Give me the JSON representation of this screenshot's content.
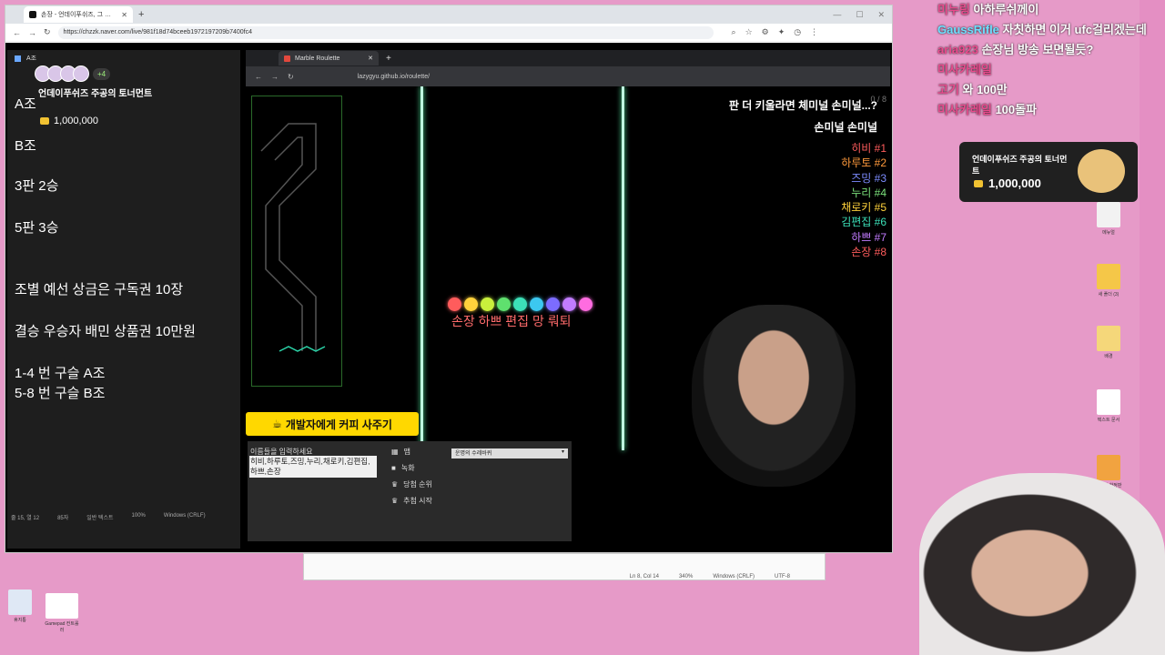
{
  "outer_browser": {
    "tab_title": "손장 - 언데이푸쉬즈, 그 주공의 토너먼트",
    "url": "https://chzzk.naver.com/live/981f18d74bceeb1972197209b7400fc4"
  },
  "notes": {
    "tab_label": "A조",
    "lines": [
      "A조",
      "B조",
      "3판 2승",
      "5판 3승",
      "조별 예선 상금은 구독권 10장",
      "결승 우승자 배민 상품권 10만원",
      "1-4 번 구슬 A조",
      "5-8 번 구슬 B조"
    ],
    "status": [
      "줄 15, 열 12",
      "85자",
      "일반 텍스트",
      "100%",
      "Windows (CRLF)"
    ]
  },
  "tourney_widget": {
    "more_count": "+4",
    "title": "언데이푸쉬즈 주공의 토너먼트",
    "prize": "1,000,000"
  },
  "inner_browser": {
    "tab_title": "Marble Roulette",
    "url": "lazygyu.github.io/roulette/"
  },
  "roulette": {
    "rank_header": "판 더 키울라면 체미널 손미널...?",
    "rank_sub": "손미널 손미널",
    "rank_count": "0 / 8",
    "ranks": [
      {
        "name": "히비 #1",
        "color": "#ff5c5c"
      },
      {
        "name": "하루토 #2",
        "color": "#ff9a3c"
      },
      {
        "name": "즈밍 #3",
        "color": "#7c8cff"
      },
      {
        "name": "누리 #4",
        "color": "#7be07b"
      },
      {
        "name": "채로키 #5",
        "color": "#ffd23c"
      },
      {
        "name": "김편집 #6",
        "color": "#3ce0b8"
      },
      {
        "name": "하쁘 #7",
        "color": "#c27cff"
      },
      {
        "name": "손장 #8",
        "color": "#ff5c5c"
      }
    ],
    "marble_colors": [
      "#ff5c5c",
      "#ffd23c",
      "#c9f03c",
      "#5fe06e",
      "#3ce0b8",
      "#3cc8f0",
      "#7c6cff",
      "#c27cff",
      "#ff6ce0"
    ],
    "marble_names": "손장 하쁘 편집 망 뤄퇴",
    "coffee_button": "개발자에게 커피 사주기",
    "names_label": "이름들을 입력하세요",
    "names_value": "히비,하루토,즈밍,누리,채로키,김편집,하쁘,손장",
    "options": [
      "맵",
      "녹화",
      "당첨 순위",
      "추첨 시작"
    ],
    "map_select": "운명의 수레바퀴"
  },
  "chat": [
    {
      "nick": "미누링",
      "msg": "아하루쉬께이"
    },
    {
      "nick": "GaussRifle",
      "msg": "자칫하면 이거 ufc걸리겠는데"
    },
    {
      "nick": "aria923",
      "msg": "손장님 방송 보면될듯?"
    },
    {
      "nick": "미사카레일",
      "msg": ""
    },
    {
      "nick": "고기",
      "msg": "와 100만"
    },
    {
      "nick": "미사카레일",
      "msg": "100돌파"
    }
  ],
  "tourney_card": {
    "title": "언데이푸쉬즈 주공의 토너먼트",
    "prize": "1,000,000"
  },
  "notepad_status": [
    "Ln 8, Col 14",
    "340%",
    "Windows (CRLF)",
    "UTF-8"
  ],
  "desktop_icons": [
    "휴지통",
    "Gamepad 컨트롤러",
    "메뉴얼",
    "새 폴더 (3)",
    "배경",
    "텍스트 문서",
    "구독권 한정판"
  ]
}
